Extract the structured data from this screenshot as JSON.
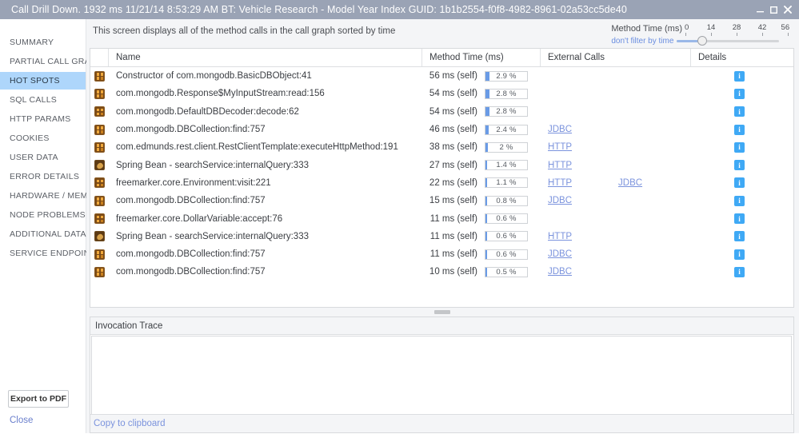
{
  "window": {
    "title": "Call Drill Down.  1932 ms  11/21/14 8:53:29 AM  BT: Vehicle Research - Model Year Index  GUID: 1b1b2554-f0f8-4982-8961-02a53cc5de40",
    "minimize_label": "—",
    "maximize_label": "❐",
    "close_label": "✕"
  },
  "sidebar": {
    "items": [
      {
        "label": "SUMMARY",
        "selected": false
      },
      {
        "label": "PARTIAL CALL GRAPH",
        "selected": false
      },
      {
        "label": "HOT SPOTS",
        "selected": true
      },
      {
        "label": "SQL CALLS",
        "selected": false
      },
      {
        "label": "HTTP PARAMS",
        "selected": false
      },
      {
        "label": "COOKIES",
        "selected": false
      },
      {
        "label": "USER DATA",
        "selected": false
      },
      {
        "label": "ERROR DETAILS",
        "selected": false
      },
      {
        "label": "HARDWARE / MEM",
        "selected": false
      },
      {
        "label": "NODE PROBLEMS",
        "selected": false
      },
      {
        "label": "ADDITIONAL DATA",
        "selected": false
      },
      {
        "label": "SERVICE ENDPOINTS",
        "selected": false
      }
    ],
    "export_pdf_label": "Export to PDF",
    "close_label": "Close"
  },
  "toolbar": {
    "description": "This screen displays all of the method calls in the call graph sorted by time",
    "filter_label": "Method Time (ms)",
    "dont_filter_label": "don't filter by time",
    "tick_labels": [
      "0",
      "14",
      "28",
      "42",
      "56"
    ],
    "slider_value": 14,
    "slider_min": 0,
    "slider_max": 56
  },
  "table": {
    "columns": [
      "Name",
      "Method Time (ms)",
      "External Calls",
      "Details"
    ],
    "rows": [
      {
        "icon": "method-grid-icon",
        "name": "Constructor of com.mongodb.BasicDBObject:41",
        "time": "56 ms (self)",
        "pct_text": "2.9 %",
        "pct": 2.9,
        "ext1": "",
        "ext2": "",
        "details": "i"
      },
      {
        "icon": "method-grid-icon",
        "name": "com.mongodb.Response$MyInputStream:read:156",
        "time": "54 ms (self)",
        "pct_text": "2.8 %",
        "pct": 2.8,
        "ext1": "",
        "ext2": "",
        "details": "i"
      },
      {
        "icon": "method-grid-icon",
        "name": "com.mongodb.DefaultDBDecoder:decode:62",
        "time": "54 ms (self)",
        "pct_text": "2.8 %",
        "pct": 2.8,
        "ext1": "",
        "ext2": "",
        "details": "i"
      },
      {
        "icon": "method-grid-icon",
        "name": "com.mongodb.DBCollection:find:757",
        "time": "46 ms (self)",
        "pct_text": "2.4 %",
        "pct": 2.4,
        "ext1": "JDBC",
        "ext2": "",
        "details": "i"
      },
      {
        "icon": "method-grid-icon",
        "name": "com.edmunds.rest.client.RestClientTemplate:executeHttpMethod:191",
        "time": "38 ms (self)",
        "pct_text": "2 %",
        "pct": 2.0,
        "ext1": "HTTP",
        "ext2": "",
        "details": "i"
      },
      {
        "icon": "spring-bean-icon",
        "name": "Spring Bean - searchService:internalQuery:333",
        "time": "27 ms (self)",
        "pct_text": "1.4 %",
        "pct": 1.4,
        "ext1": "HTTP",
        "ext2": "",
        "details": "i"
      },
      {
        "icon": "method-grid-icon",
        "name": "freemarker.core.Environment:visit:221",
        "time": "22 ms (self)",
        "pct_text": "1.1 %",
        "pct": 1.1,
        "ext1": "HTTP",
        "ext2": "JDBC",
        "details": "i"
      },
      {
        "icon": "method-grid-icon",
        "name": "com.mongodb.DBCollection:find:757",
        "time": "15 ms (self)",
        "pct_text": "0.8 %",
        "pct": 0.8,
        "ext1": "JDBC",
        "ext2": "",
        "details": "i"
      },
      {
        "icon": "method-grid-icon",
        "name": "freemarker.core.DollarVariable:accept:76",
        "time": "11 ms (self)",
        "pct_text": "0.6 %",
        "pct": 0.6,
        "ext1": "",
        "ext2": "",
        "details": "i"
      },
      {
        "icon": "spring-bean-icon",
        "name": "Spring Bean - searchService:internalQuery:333",
        "time": "11 ms (self)",
        "pct_text": "0.6 %",
        "pct": 0.6,
        "ext1": "HTTP",
        "ext2": "",
        "details": "i"
      },
      {
        "icon": "method-grid-icon",
        "name": "com.mongodb.DBCollection:find:757",
        "time": "11 ms (self)",
        "pct_text": "0.6 %",
        "pct": 0.6,
        "ext1": "JDBC",
        "ext2": "",
        "details": "i"
      },
      {
        "icon": "method-grid-icon",
        "name": "com.mongodb.DBCollection:find:757",
        "time": "10 ms (self)",
        "pct_text": "0.5 %",
        "pct": 0.5,
        "ext1": "JDBC",
        "ext2": "",
        "details": "i"
      }
    ]
  },
  "trace": {
    "header": "Invocation Trace",
    "content": "",
    "copy_label": "Copy to clipboard"
  },
  "colors": {
    "title_bar": "#9aa3b5",
    "selection": "#aed6fb",
    "link": "#7b93dd",
    "info_icon": "#3fa9f5",
    "bar_fill": "#6a9be6"
  }
}
